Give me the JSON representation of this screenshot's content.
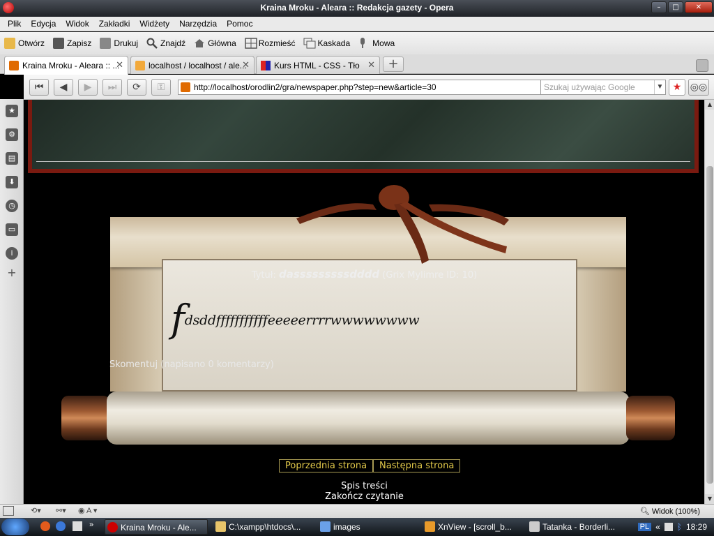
{
  "window": {
    "title": "Kraina Mroku - Aleara :: Redakcja gazety - Opera"
  },
  "menu": [
    "Plik",
    "Edycja",
    "Widok",
    "Zakładki",
    "Widżety",
    "Narzędzia",
    "Pomoc"
  ],
  "toolbar": {
    "open": "Otwórz",
    "save": "Zapisz",
    "print": "Drukuj",
    "find": "Znajdź",
    "home": "Główna",
    "tile": "Rozmieść",
    "cascade": "Kaskada",
    "voice": "Mowa"
  },
  "tabs": [
    {
      "label": "Kraina Mroku - Aleara :: ..."
    },
    {
      "label": "localhost / localhost / ale..."
    },
    {
      "label": "Kurs HTML - CSS - Tło"
    }
  ],
  "address": {
    "url": "http://localhost/orodlin2/gra/newspaper.php?step=new&article=30",
    "search_placeholder": "Szukaj używając Google"
  },
  "article": {
    "title_prefix": "Tytuł:",
    "title": "dasssssssssdddd",
    "author": "(Grix Mylimre ID: 10)",
    "dropcap": "f",
    "body": "dsddfffffffffffeeeeerrrrwwwwwwww",
    "comment_link": "Skomentuj (napisano 0 komentarzy)"
  },
  "pager": {
    "prev": "Poprzednia strona",
    "next": "Następna strona"
  },
  "links": {
    "toc": "Spis treści",
    "end": "Zakończ czytanie"
  },
  "status": {
    "zoom": "Widok (100%)"
  },
  "taskbar": {
    "items": [
      "Kraina Mroku - Ale...",
      "C:\\xampp\\htdocs\\...",
      "images",
      "XnView - [scroll_b...",
      "Tatanka - Borderli..."
    ],
    "lang": "PL",
    "clock": "18:29"
  }
}
